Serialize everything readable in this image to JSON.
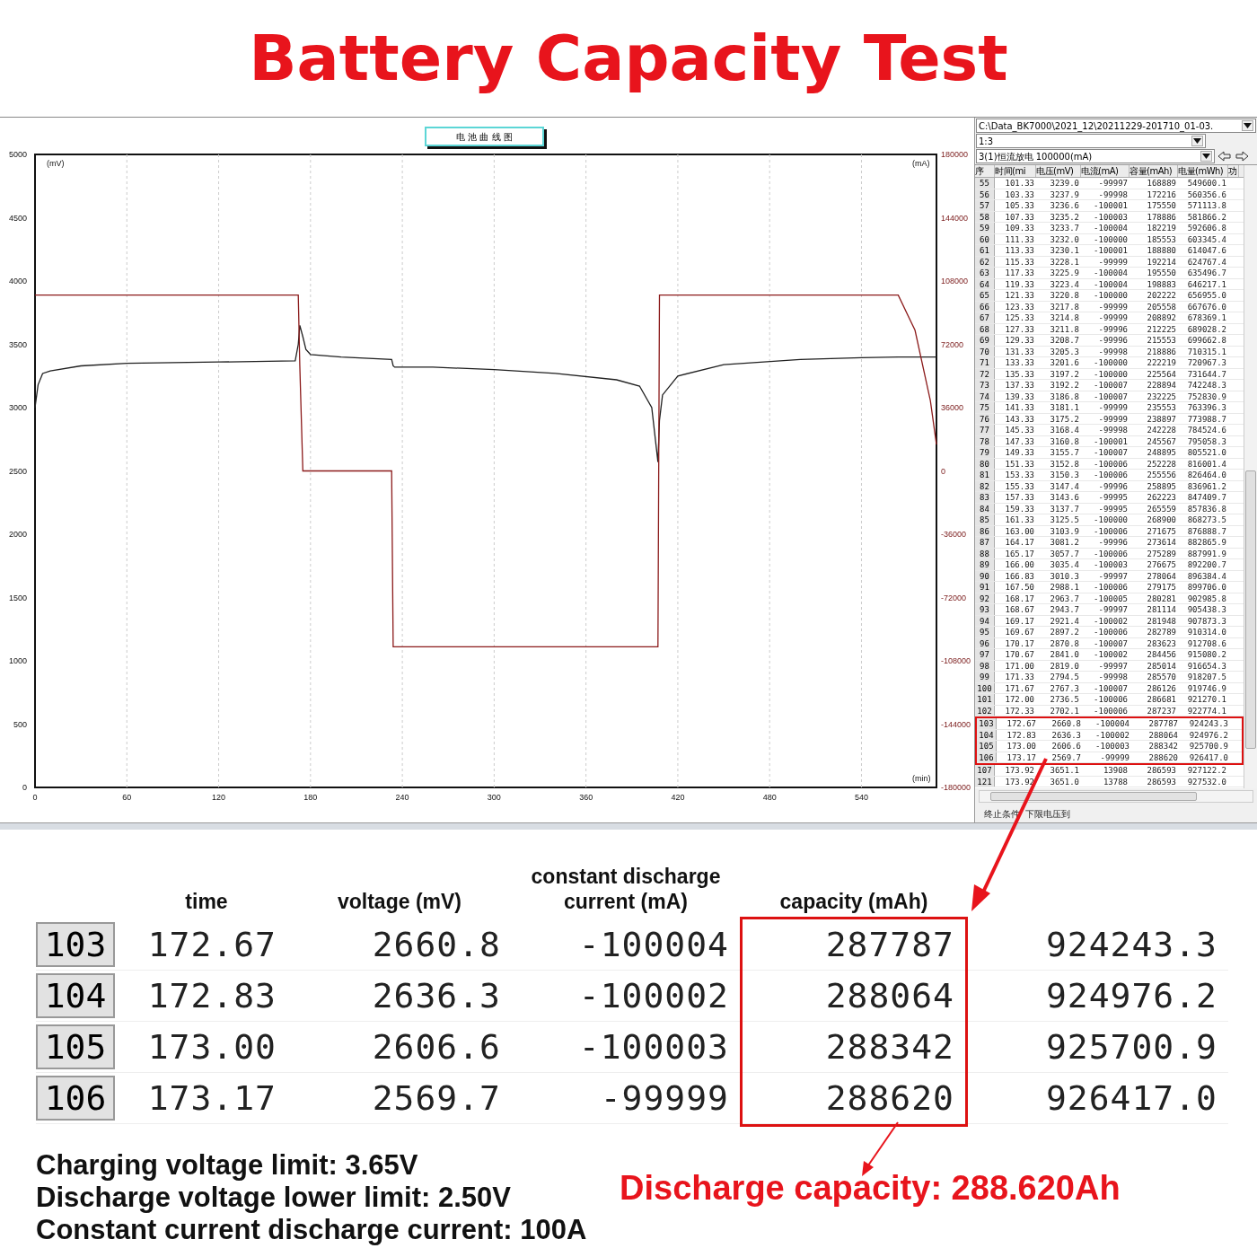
{
  "title": "Battery Capacity Test",
  "chart_window": {
    "chart_title": "电 池 曲 线 图",
    "left_unit": "(mV)",
    "right_unit": "(mA)",
    "x_unit": "(min)",
    "chart_data": {
      "type": "line",
      "grid": true,
      "xlim": [
        0,
        589
      ],
      "y2ticks": [
        180000,
        144000,
        108000,
        72000,
        36000,
        0,
        -36000,
        -72000,
        -108000,
        -144000,
        -180000
      ],
      "ylim": [
        0,
        5000
      ],
      "y2lim": [
        -180000,
        180000
      ],
      "xticks": [
        0,
        60,
        120,
        180,
        240,
        300,
        360,
        420,
        480,
        540
      ],
      "yticks": [
        0,
        500,
        1000,
        1500,
        2000,
        2500,
        3000,
        3500,
        4000,
        4500,
        5000
      ],
      "x": [
        0,
        2,
        5,
        10,
        30,
        60,
        120,
        170,
        172,
        173,
        175,
        177,
        180,
        200,
        233,
        234,
        235,
        260,
        300,
        340,
        380,
        395,
        403,
        407,
        408,
        410,
        420,
        450,
        500,
        540,
        564,
        575,
        585,
        589
      ],
      "series": [
        {
          "color": "#202020",
          "values": [
            3000,
            3180,
            3270,
            3290,
            3330,
            3350,
            3360,
            3370,
            3500,
            3650,
            3560,
            3460,
            3420,
            3400,
            3380,
            3330,
            3320,
            3320,
            3300,
            3270,
            3220,
            3170,
            3000,
            2570,
            2900,
            3100,
            3250,
            3340,
            3380,
            3395,
            3400,
            3400,
            3400,
            3400
          ]
        },
        {
          "color": "#8b1a1a",
          "axis": "y2",
          "values": [
            100000,
            100000,
            100000,
            100000,
            100000,
            100000,
            100000,
            100000,
            100000,
            60000,
            0,
            0,
            0,
            0,
            0,
            -100000,
            -100000,
            -100000,
            -100000,
            -100000,
            -100000,
            -100000,
            -100000,
            -100000,
            100000,
            100000,
            100000,
            100000,
            100000,
            100000,
            100000,
            80000,
            40000,
            15000
          ]
        }
      ]
    }
  },
  "data_panel": {
    "path": "C:\\Data_BK7000\\2021_12\\20211229-201710_01-03.",
    "group": "1:3",
    "step": "3(1)恒流放电 100000(mA)",
    "columns": [
      "序",
      "时间(mi",
      "电压(mV)",
      "电流(mA)",
      "容量(mAh)",
      "电量(mWh)",
      "功"
    ],
    "rows": [
      {
        "cells": [
          "55",
          "101.33",
          "3239.0",
          "-99997",
          "168889",
          "549600.1"
        ],
        "highlighted": false
      },
      {
        "cells": [
          "56",
          "103.33",
          "3237.9",
          "-99998",
          "172216",
          "560356.6"
        ],
        "highlighted": false
      },
      {
        "cells": [
          "57",
          "105.33",
          "3236.6",
          "-100001",
          "175550",
          "571113.8"
        ],
        "highlighted": false
      },
      {
        "cells": [
          "58",
          "107.33",
          "3235.2",
          "-100003",
          "178886",
          "581866.2"
        ],
        "highlighted": false
      },
      {
        "cells": [
          "59",
          "109.33",
          "3233.7",
          "-100004",
          "182219",
          "592606.8"
        ],
        "highlighted": false
      },
      {
        "cells": [
          "60",
          "111.33",
          "3232.0",
          "-100000",
          "185553",
          "603345.4"
        ],
        "highlighted": false
      },
      {
        "cells": [
          "61",
          "113.33",
          "3230.1",
          "-100001",
          "188880",
          "614047.6"
        ],
        "highlighted": false
      },
      {
        "cells": [
          "62",
          "115.33",
          "3228.1",
          "-99999",
          "192214",
          "624767.4"
        ],
        "highlighted": false
      },
      {
        "cells": [
          "63",
          "117.33",
          "3225.9",
          "-100004",
          "195550",
          "635496.7"
        ],
        "highlighted": false
      },
      {
        "cells": [
          "64",
          "119.33",
          "3223.4",
          "-100004",
          "198883",
          "646217.1"
        ],
        "highlighted": false
      },
      {
        "cells": [
          "65",
          "121.33",
          "3220.8",
          "-100000",
          "202222",
          "656955.0"
        ],
        "highlighted": false
      },
      {
        "cells": [
          "66",
          "123.33",
          "3217.8",
          "-99999",
          "205558",
          "667676.0"
        ],
        "highlighted": false
      },
      {
        "cells": [
          "67",
          "125.33",
          "3214.8",
          "-99999",
          "208892",
          "678369.1"
        ],
        "highlighted": false
      },
      {
        "cells": [
          "68",
          "127.33",
          "3211.8",
          "-99996",
          "212225",
          "689028.2"
        ],
        "highlighted": false
      },
      {
        "cells": [
          "69",
          "129.33",
          "3208.7",
          "-99996",
          "215553",
          "699662.8"
        ],
        "highlighted": false
      },
      {
        "cells": [
          "70",
          "131.33",
          "3205.3",
          "-99998",
          "218886",
          "710315.1"
        ],
        "highlighted": false
      },
      {
        "cells": [
          "71",
          "133.33",
          "3201.6",
          "-100000",
          "222219",
          "720967.3"
        ],
        "highlighted": false
      },
      {
        "cells": [
          "72",
          "135.33",
          "3197.2",
          "-100000",
          "225564",
          "731644.7"
        ],
        "highlighted": false
      },
      {
        "cells": [
          "73",
          "137.33",
          "3192.2",
          "-100007",
          "228894",
          "742248.3"
        ],
        "highlighted": false
      },
      {
        "cells": [
          "74",
          "139.33",
          "3186.8",
          "-100007",
          "232225",
          "752830.9"
        ],
        "highlighted": false
      },
      {
        "cells": [
          "75",
          "141.33",
          "3181.1",
          "-99999",
          "235553",
          "763396.3"
        ],
        "highlighted": false
      },
      {
        "cells": [
          "76",
          "143.33",
          "3175.2",
          "-99999",
          "238897",
          "773988.7"
        ],
        "highlighted": false
      },
      {
        "cells": [
          "77",
          "145.33",
          "3168.4",
          "-99998",
          "242228",
          "784524.6"
        ],
        "highlighted": false
      },
      {
        "cells": [
          "78",
          "147.33",
          "3160.8",
          "-100001",
          "245567",
          "795058.3"
        ],
        "highlighted": false
      },
      {
        "cells": [
          "79",
          "149.33",
          "3155.7",
          "-100007",
          "248895",
          "805521.0"
        ],
        "highlighted": false
      },
      {
        "cells": [
          "80",
          "151.33",
          "3152.8",
          "-100006",
          "252228",
          "816001.4"
        ],
        "highlighted": false
      },
      {
        "cells": [
          "81",
          "153.33",
          "3150.3",
          "-100006",
          "255556",
          "826464.0"
        ],
        "highlighted": false
      },
      {
        "cells": [
          "82",
          "155.33",
          "3147.4",
          "-99996",
          "258895",
          "836961.2"
        ],
        "highlighted": false
      },
      {
        "cells": [
          "83",
          "157.33",
          "3143.6",
          "-99995",
          "262223",
          "847409.7"
        ],
        "highlighted": false
      },
      {
        "cells": [
          "84",
          "159.33",
          "3137.7",
          "-99995",
          "265559",
          "857836.8"
        ],
        "highlighted": false
      },
      {
        "cells": [
          "85",
          "161.33",
          "3125.5",
          "-100000",
          "268900",
          "868273.5"
        ],
        "highlighted": false
      },
      {
        "cells": [
          "86",
          "163.00",
          "3103.9",
          "-100006",
          "271675",
          "876888.7"
        ],
        "highlighted": false
      },
      {
        "cells": [
          "87",
          "164.17",
          "3081.2",
          "-99996",
          "273614",
          "882865.9"
        ],
        "highlighted": false
      },
      {
        "cells": [
          "88",
          "165.17",
          "3057.7",
          "-100006",
          "275289",
          "887991.9"
        ],
        "highlighted": false
      },
      {
        "cells": [
          "89",
          "166.00",
          "3035.4",
          "-100003",
          "276675",
          "892200.7"
        ],
        "highlighted": false
      },
      {
        "cells": [
          "90",
          "166.83",
          "3010.3",
          "-99997",
          "278064",
          "896384.4"
        ],
        "highlighted": false
      },
      {
        "cells": [
          "91",
          "167.50",
          "2988.1",
          "-100006",
          "279175",
          "899706.0"
        ],
        "highlighted": false
      },
      {
        "cells": [
          "92",
          "168.17",
          "2963.7",
          "-100005",
          "280281",
          "902985.8"
        ],
        "highlighted": false
      },
      {
        "cells": [
          "93",
          "168.67",
          "2943.7",
          "-99997",
          "281114",
          "905438.3"
        ],
        "highlighted": false
      },
      {
        "cells": [
          "94",
          "169.17",
          "2921.4",
          "-100002",
          "281948",
          "907873.3"
        ],
        "highlighted": false
      },
      {
        "cells": [
          "95",
          "169.67",
          "2897.2",
          "-100006",
          "282789",
          "910314.0"
        ],
        "highlighted": false
      },
      {
        "cells": [
          "96",
          "170.17",
          "2870.8",
          "-100007",
          "283623",
          "912708.6"
        ],
        "highlighted": false
      },
      {
        "cells": [
          "97",
          "170.67",
          "2841.0",
          "-100002",
          "284456",
          "915080.2"
        ],
        "highlighted": false
      },
      {
        "cells": [
          "98",
          "171.00",
          "2819.0",
          "-99997",
          "285014",
          "916654.3"
        ],
        "highlighted": false
      },
      {
        "cells": [
          "99",
          "171.33",
          "2794.5",
          "-99998",
          "285570",
          "918207.5"
        ],
        "highlighted": false
      },
      {
        "cells": [
          "100",
          "171.67",
          "2767.3",
          "-100007",
          "286126",
          "919746.9"
        ],
        "highlighted": false
      },
      {
        "cells": [
          "101",
          "172.00",
          "2736.5",
          "-100006",
          "286681",
          "921270.1"
        ],
        "highlighted": false
      },
      {
        "cells": [
          "102",
          "172.33",
          "2702.1",
          "-100006",
          "287237",
          "922774.1"
        ],
        "highlighted": false
      },
      {
        "cells": [
          "103",
          "172.67",
          "2660.8",
          "-100004",
          "287787",
          "924243.3"
        ],
        "highlighted": true
      },
      {
        "cells": [
          "104",
          "172.83",
          "2636.3",
          "-100002",
          "288064",
          "924976.2"
        ],
        "highlighted": true
      },
      {
        "cells": [
          "105",
          "173.00",
          "2606.6",
          "-100003",
          "288342",
          "925700.9"
        ],
        "highlighted": true
      },
      {
        "cells": [
          "106",
          "173.17",
          "2569.7",
          "-99999",
          "288620",
          "926417.0"
        ],
        "highlighted": true
      },
      {
        "cells": [
          "107",
          "173.92",
          "3651.1",
          "13908",
          "286593",
          "927122.2"
        ],
        "highlighted": false
      },
      {
        "cells": [
          "121",
          "173.92",
          "3651.0",
          "13788",
          "286593",
          "927532.0"
        ],
        "highlighted": false
      }
    ],
    "footer": [
      "终止条件",
      "下限电压到"
    ]
  },
  "zoomed_table": {
    "columns": [
      {
        "highlighted": false
      },
      {
        "label": "time",
        "highlighted": false
      },
      {
        "label": "voltage (mV)",
        "highlighted": false
      },
      {
        "label": "constant discharge current (mA)",
        "highlighted": false
      },
      {
        "label": "capacity (mAh)",
        "highlighted": true
      },
      {
        "highlighted": false
      }
    ],
    "rows": [
      [
        "103",
        "172.67",
        "2660.8",
        "-100004",
        "287787",
        "924243.3"
      ],
      [
        "104",
        "172.83",
        "2636.3",
        "-100002",
        "288064",
        "924976.2"
      ],
      [
        "105",
        "173.00",
        "2606.6",
        "-100003",
        "288342",
        "925700.9"
      ],
      [
        "106",
        "173.17",
        "2569.7",
        "-99999",
        "288620",
        "926417.0"
      ]
    ]
  },
  "notes": [
    "Charging voltage limit: 3.65V",
    "Discharge voltage lower limit: 2.50V",
    "Constant current discharge current: 100A"
  ],
  "result": "Discharge capacity: 288.620Ah"
}
